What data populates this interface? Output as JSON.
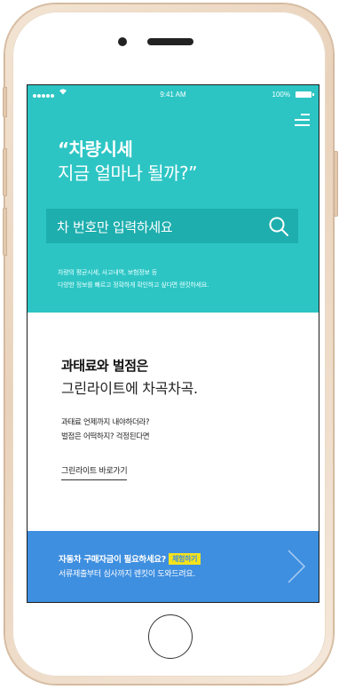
{
  "status_bar": {
    "time": "9:41 AM",
    "battery": "100%",
    "signal_icon": "signal-dots-icon",
    "wifi_icon": "wifi-icon",
    "battery_icon": "battery-icon"
  },
  "header": {
    "headline_line1": "“차량시세",
    "headline_line2": "지금 얼마나 될까?”",
    "menu_icon": "hamburger-menu-icon"
  },
  "search": {
    "placeholder": "차 번호만 입력하세요",
    "icon": "search-icon"
  },
  "description": {
    "line1": "차량의 평균시세, 사고내역, 보험정보 등",
    "line2": "다양한 정보를 빠르고 정확하게 확인하고 싶다면 렌킷하세요."
  },
  "penalty_section": {
    "title_bold": "과태료와 벌점은",
    "title": "그린라이트에 차곡차곡.",
    "body_line1": "과태료 언제까지 내야하더라?",
    "body_line2": "벌점은 어떡하지? 걱정된다면",
    "link": "그린라이트 바로가기"
  },
  "banner": {
    "title": "자동차 구매자금이 필요하세요?",
    "badge": "체험하기",
    "subtitle": "서류제출부터 심사까지 렌킷이 도와드려요.",
    "arrow_icon": "chevron-right-icon"
  },
  "colors": {
    "teal": "#2cc5c4",
    "search_bg": "#1eaeae",
    "banner_blue": "#3f8fe0",
    "badge_yellow": "#f4e21c"
  }
}
